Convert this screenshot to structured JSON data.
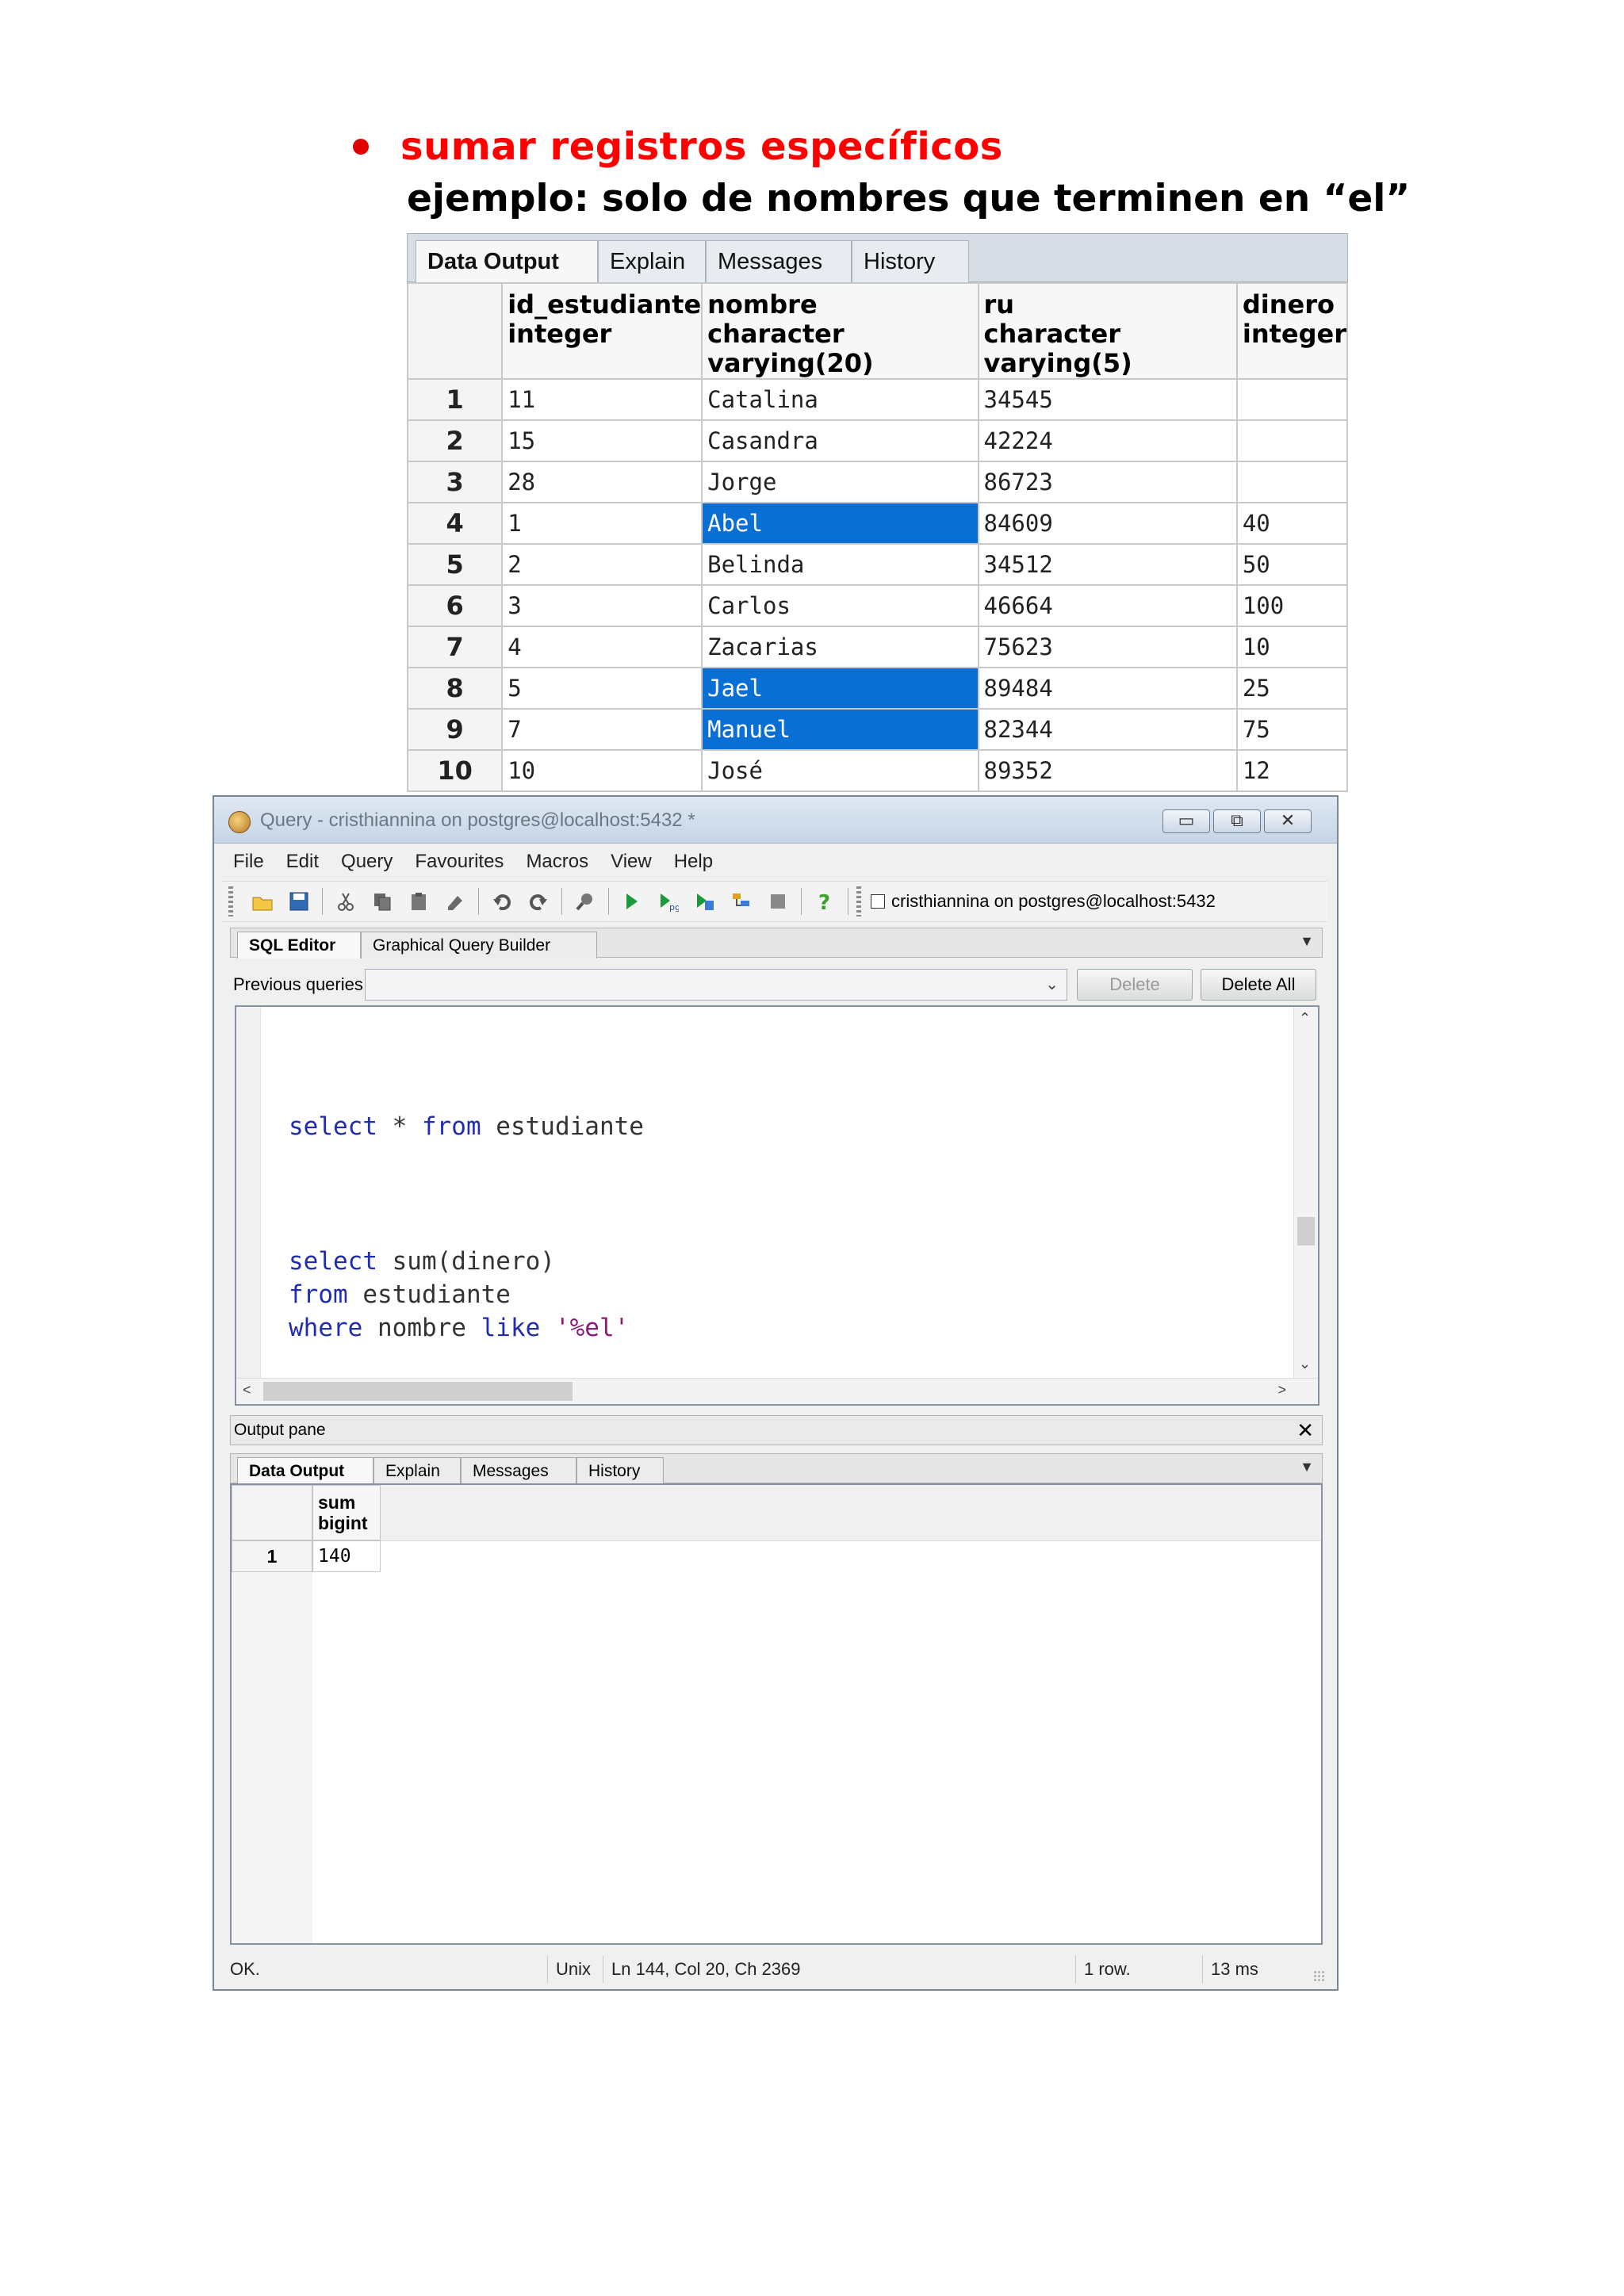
{
  "heading": {
    "bullet": "sumar registros específicos",
    "example": "ejemplo: solo de nombres que terminen en “el”"
  },
  "top_grid": {
    "tabs": [
      "Data Output",
      "Explain",
      "Messages",
      "History"
    ],
    "columns": [
      {
        "name": "id_estudiante",
        "type": "integer"
      },
      {
        "name": "nombre",
        "type": "character varying(20)"
      },
      {
        "name": "ru",
        "type": "character varying(5)"
      },
      {
        "name": "dinero",
        "type": "integer"
      }
    ],
    "rows": [
      {
        "n": "1",
        "id": "11",
        "nombre": "Catalina",
        "ru": "34545",
        "dinero": "",
        "sel": false
      },
      {
        "n": "2",
        "id": "15",
        "nombre": "Casandra",
        "ru": "42224",
        "dinero": "",
        "sel": false
      },
      {
        "n": "3",
        "id": "28",
        "nombre": "Jorge",
        "ru": "86723",
        "dinero": "",
        "sel": false
      },
      {
        "n": "4",
        "id": "1",
        "nombre": "Abel",
        "ru": "84609",
        "dinero": "40",
        "sel": true
      },
      {
        "n": "5",
        "id": "2",
        "nombre": "Belinda",
        "ru": "34512",
        "dinero": "50",
        "sel": false
      },
      {
        "n": "6",
        "id": "3",
        "nombre": "Carlos",
        "ru": "46664",
        "dinero": "100",
        "sel": false
      },
      {
        "n": "7",
        "id": "4",
        "nombre": "Zacarias",
        "ru": "75623",
        "dinero": "10",
        "sel": false
      },
      {
        "n": "8",
        "id": "5",
        "nombre": "Jael",
        "ru": "89484",
        "dinero": "25",
        "sel": true
      },
      {
        "n": "9",
        "id": "7",
        "nombre": "Manuel",
        "ru": "82344",
        "dinero": "75",
        "sel": true
      },
      {
        "n": "10",
        "id": "10",
        "nombre": "José",
        "ru": "89352",
        "dinero": "12",
        "sel": false
      }
    ],
    "selection_color": "#0a6fd4"
  },
  "window": {
    "title": "Query - cristhiannina on postgres@localhost:5432 *",
    "controls": [
      "▭",
      "⧉",
      "✕"
    ],
    "menu": [
      "File",
      "Edit",
      "Query",
      "Favourites",
      "Macros",
      "View",
      "Help"
    ],
    "connection": "cristhiannina on postgres@localhost:5432",
    "toolbar_icons": [
      "open-icon",
      "save-icon",
      "cut-icon",
      "copy-icon",
      "paste-icon",
      "clear-icon",
      "undo-icon",
      "redo-icon",
      "find-icon",
      "execute-icon",
      "execute-pgscript-icon",
      "execute-to-file-icon",
      "explain-icon",
      "stop-icon",
      "help-icon"
    ],
    "editor_tabs": [
      "SQL Editor",
      "Graphical Query Builder"
    ],
    "previous_queries_label": "Previous queries",
    "delete_label": "Delete",
    "delete_all_label": "Delete All",
    "code": {
      "q1": {
        "kw1": "select",
        "rest1": " * ",
        "kw2": "from",
        "rest2": " estudiante"
      },
      "q2_l1": {
        "kw": "select",
        "rest": " sum(dinero)"
      },
      "q2_l2": {
        "kw": "from",
        "rest": " estudiante"
      },
      "q2_l3": {
        "kw1": "where",
        "mid": " nombre ",
        "kw2": "like",
        "sp": " ",
        "str": "'%el'"
      }
    },
    "output_pane_label": "Output pane",
    "output_tabs": [
      "Data Output",
      "Explain",
      "Messages",
      "History"
    ],
    "result": {
      "col_name": "sum",
      "col_type": "bigint",
      "row_num": "1",
      "value": "140"
    },
    "status": {
      "msg": "OK.",
      "eol": "Unix",
      "pos": "Ln 144, Col 20, Ch 2369",
      "rows": "1 row.",
      "time": "13 ms"
    }
  }
}
